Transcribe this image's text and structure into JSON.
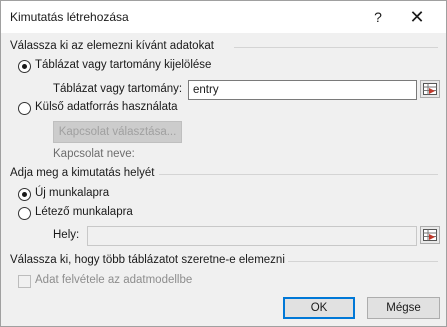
{
  "window": {
    "title": "Kimutatás létrehozása",
    "help_label": "?",
    "close_label": "✕"
  },
  "section_data": {
    "title": "Válassza ki az elemezni kívánt adatokat",
    "option_table_label": "Táblázat vagy tartomány kijelölése",
    "option_table_selected": true,
    "table_range_label": "Táblázat vagy tartomány:",
    "table_range_value": "entry",
    "option_external_label": "Külső adatforrás használata",
    "option_external_selected": false,
    "choose_connection_label": "Kapcsolat választása...",
    "connection_name_label": "Kapcsolat neve:"
  },
  "section_location": {
    "title": "Adja meg a kimutatás helyét",
    "option_new_sheet_label": "Új munkalapra",
    "option_new_sheet_selected": true,
    "option_existing_sheet_label": "Létező munkalapra",
    "option_existing_sheet_selected": false,
    "location_label": "Hely:",
    "location_value": ""
  },
  "section_multiple": {
    "title": "Válassza ki, hogy több táblázatot szeretne-e elemezni",
    "add_to_data_model_label": "Adat felvétele az adatmodellbe",
    "add_to_data_model_checked": false
  },
  "footer": {
    "ok_label": "OK",
    "cancel_label": "Mégse"
  }
}
